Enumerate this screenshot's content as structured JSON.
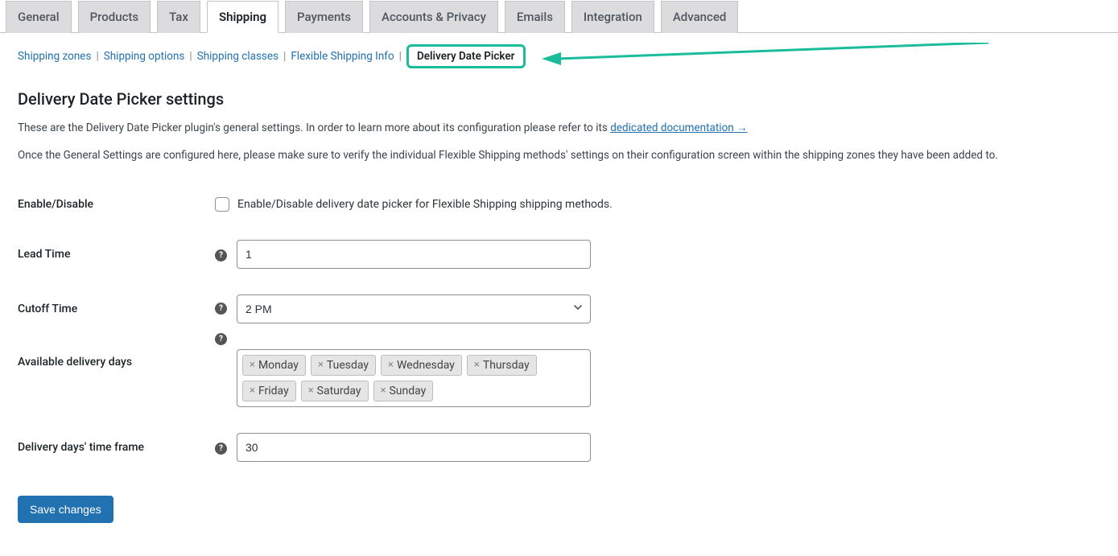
{
  "tabs": {
    "general": "General",
    "products": "Products",
    "tax": "Tax",
    "shipping": "Shipping",
    "payments": "Payments",
    "accounts": "Accounts & Privacy",
    "emails": "Emails",
    "integration": "Integration",
    "advanced": "Advanced"
  },
  "subtabs": {
    "zones": "Shipping zones",
    "options": "Shipping options",
    "classes": "Shipping classes",
    "flexinfo": "Flexible Shipping Info",
    "ddp": "Delivery Date Picker"
  },
  "heading": "Delivery Date Picker settings",
  "desc1_pre": "These are the Delivery Date Picker plugin's general settings. In order to learn more about its configuration please refer to its ",
  "desc1_link": "dedicated documentation →",
  "desc2": "Once the General Settings are configured here, please make sure to verify the individual Flexible Shipping methods' settings on their configuration screen within the shipping zones they have been added to.",
  "labels": {
    "enable": "Enable/Disable",
    "enable_cb": "Enable/Disable delivery date picker for Flexible Shipping shipping methods.",
    "lead": "Lead Time",
    "cutoff": "Cutoff Time",
    "avail": "Available delivery days",
    "frame": "Delivery days' time frame"
  },
  "values": {
    "lead": "1",
    "cutoff": "2 PM",
    "frame": "30"
  },
  "days": [
    "Monday",
    "Tuesday",
    "Wednesday",
    "Thursday",
    "Friday",
    "Saturday",
    "Sunday"
  ],
  "save": "Save changes",
  "annotation_color": "#1abc9c"
}
